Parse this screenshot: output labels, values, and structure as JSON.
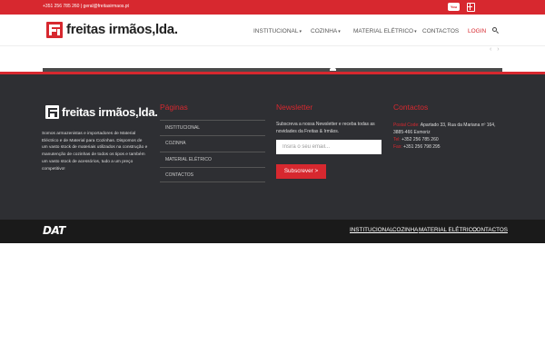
{
  "topbar": {
    "contact": "+351 256 785 260 | geral@freitasirmaos.pt",
    "youtube_label": "You"
  },
  "brand": {
    "name": "freitas irmãos,lda.",
    "color": "#d7282f"
  },
  "nav": {
    "items": [
      {
        "label": "INSTITUCIONAL",
        "caret": "▾"
      },
      {
        "label": "COZINHA",
        "caret": "▾"
      },
      {
        "label": "MATERIAL ELÉTRICO",
        "caret": "▾"
      },
      {
        "label": "CONTACTOS",
        "caret": ""
      },
      {
        "label": "LOGIN",
        "caret": ""
      }
    ],
    "search_icon": "search-icon"
  },
  "slider": {
    "prev": "‹",
    "next": "›"
  },
  "footer": {
    "about": "Somos armazenistas e importadores de Material Eléctrico e de Material para Cozinhas. Dispomos de um vasto stock de materiais utilizados na construção e manutenção de cozinhas de todos os tipos e também um vasto stock de acessórios, tudo a um preço competitivo!",
    "pages_title": "Páginas",
    "pages": [
      "INSTITUCIONAL",
      "COZINHA",
      "MATERIAL ELÉTRICO",
      "CONTACTOS"
    ],
    "newsletter_title": "Newsletter",
    "newsletter_text": "Subscreva a nossa Newsletter e receba todas as novidades da Freitas & Irmãos.",
    "newsletter_placeholder": "Insira o seu email...",
    "subscribe_label": "Subscrever >",
    "contacts_title": "Contactos",
    "contacts": {
      "postal_label": "Postal Code:",
      "postal_value": "Apartado 33, Rua da Mariana nº 164, 3885-466 Esmoriz",
      "tel_label": "Tel:",
      "tel_value": "+352 256 785 260",
      "fax_label": "Fax:",
      "fax_value": "+351 256 798 295"
    }
  },
  "bottombar": {
    "logo": "DAT",
    "links": [
      "INSTITUCIONAL",
      "COZINHA",
      "MATERIAL ELÉTRICO",
      "CONTACTOS"
    ]
  }
}
